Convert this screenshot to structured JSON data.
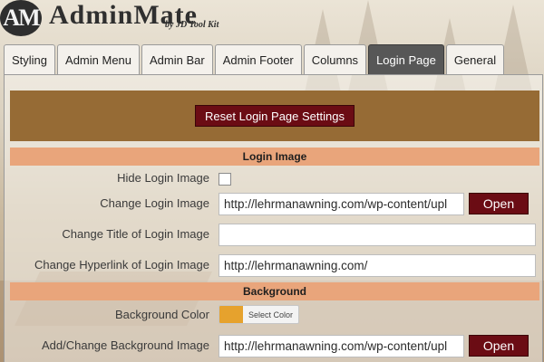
{
  "logo": {
    "badge": "AM",
    "name": "AdminMate",
    "subtitle": "by JD Tool Kit"
  },
  "tabs": [
    {
      "label": "Styling"
    },
    {
      "label": "Admin Menu"
    },
    {
      "label": "Admin Bar"
    },
    {
      "label": "Admin Footer"
    },
    {
      "label": "Columns"
    },
    {
      "label": "Login Page",
      "active": true
    },
    {
      "label": "General"
    }
  ],
  "reset_button": "Reset Login Page Settings",
  "sections": {
    "login_image": "Login Image",
    "background": "Background"
  },
  "fields": {
    "hide_login_image": {
      "label": "Hide Login Image",
      "checked": false
    },
    "change_login_image": {
      "label": "Change Login Image",
      "value": "http://lehrmanawning.com/wp-content/upl",
      "button": "Open"
    },
    "change_title": {
      "label": "Change Title of Login Image",
      "value": ""
    },
    "change_hyperlink": {
      "label": "Change Hyperlink of Login Image",
      "value": "http://lehrmanawning.com/"
    },
    "background_color": {
      "label": "Background Color",
      "button": "Select Color",
      "color": "#e6a22d"
    },
    "background_image": {
      "label": "Add/Change Background Image",
      "value": "http://lehrmanawning.com/wp-content/upl",
      "button": "Open"
    }
  },
  "colors": {
    "tab_active": "#575757",
    "reset_bar": "#966b35",
    "section_header": "#e9a57b",
    "dark_button": "#6b0c14"
  }
}
